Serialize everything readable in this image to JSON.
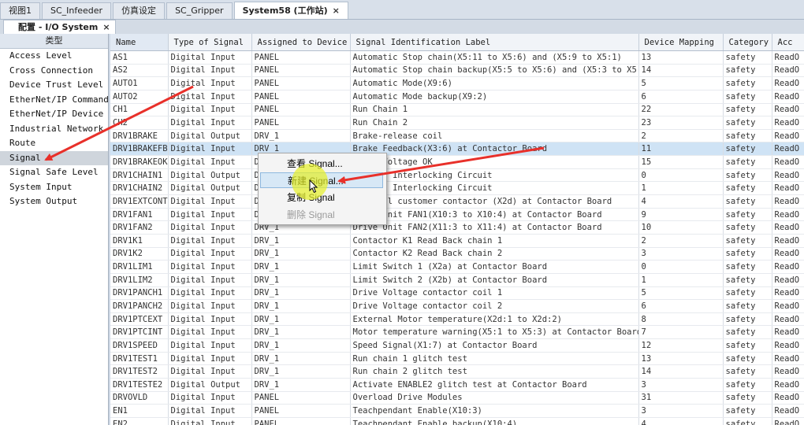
{
  "doc_tabs": [
    {
      "label": "视图1",
      "active": false
    },
    {
      "label": "SC_Infeeder",
      "active": false
    },
    {
      "label": "仿真设定",
      "active": false
    },
    {
      "label": "SC_Gripper",
      "active": false
    },
    {
      "label": "System58 (工作站)",
      "active": true
    }
  ],
  "sub_tab": {
    "label": "配置 - I/O System"
  },
  "left_panel": {
    "header": "类型",
    "items": [
      "Access Level",
      "Cross Connection",
      "Device Trust Level",
      "EtherNet/IP Command",
      "EtherNet/IP Device",
      "Industrial Network",
      "Route",
      "Signal",
      "Signal Safe Level",
      "System Input",
      "System Output"
    ],
    "selected": "Signal"
  },
  "table": {
    "columns": [
      "Name",
      "Type of Signal",
      "Assigned to Device",
      "Signal Identification Label",
      "Device Mapping",
      "Category",
      "Acc"
    ],
    "rows": [
      [
        "AS1",
        "Digital Input",
        "PANEL",
        "Automatic Stop chain(X5:11 to X5:6) and (X5:9 to X5:1)",
        "13",
        "safety",
        "ReadO"
      ],
      [
        "AS2",
        "Digital Input",
        "PANEL",
        "Automatic Stop chain backup(X5:5 to X5:6) and (X5:3 to X5:1)",
        "14",
        "safety",
        "ReadO"
      ],
      [
        "AUTO1",
        "Digital Input",
        "PANEL",
        "Automatic Mode(X9:6)",
        "5",
        "safety",
        "ReadO"
      ],
      [
        "AUTO2",
        "Digital Input",
        "PANEL",
        "Automatic Mode backup(X9:2)",
        "6",
        "safety",
        "ReadO"
      ],
      [
        "CH1",
        "Digital Input",
        "PANEL",
        "Run Chain 1",
        "22",
        "safety",
        "ReadO"
      ],
      [
        "CH2",
        "Digital Input",
        "PANEL",
        "Run Chain 2",
        "23",
        "safety",
        "ReadO"
      ],
      [
        "DRV1BRAKE",
        "Digital Output",
        "DRV_1",
        "Brake-release coil",
        "2",
        "safety",
        "ReadO"
      ],
      [
        "DRV1BRAKEFB",
        "Digital Input",
        "DRV_1",
        "Brake Feedback(X3:6) at Contactor Board",
        "11",
        "safety",
        "ReadO"
      ],
      [
        "DRV1BRAKEOK",
        "Digital Input",
        "DRV_1",
        "Brake Voltage OK",
        "15",
        "safety",
        "ReadO"
      ],
      [
        "DRV1CHAIN1",
        "Digital Output",
        "DRV_1",
        "Chain 1 Interlocking Circuit",
        "0",
        "safety",
        "ReadO"
      ],
      [
        "DRV1CHAIN2",
        "Digital Output",
        "DRV_1",
        "Chain 2 Interlocking Circuit",
        "1",
        "safety",
        "ReadO"
      ],
      [
        "DRV1EXTCONT",
        "Digital Input",
        "DRV_1",
        "External customer contactor (X2d) at Contactor Board",
        "4",
        "safety",
        "ReadO"
      ],
      [
        "DRV1FAN1",
        "Digital Input",
        "DRV_1",
        "Drive Unit FAN1(X10:3 to X10:4) at Contactor Board",
        "9",
        "safety",
        "ReadO"
      ],
      [
        "DRV1FAN2",
        "Digital Input",
        "DRV_1",
        "Drive Unit FAN2(X11:3 to X11:4) at Contactor Board",
        "10",
        "safety",
        "ReadO"
      ],
      [
        "DRV1K1",
        "Digital Input",
        "DRV_1",
        "Contactor K1 Read Back chain 1",
        "2",
        "safety",
        "ReadO"
      ],
      [
        "DRV1K2",
        "Digital Input",
        "DRV_1",
        "Contactor K2 Read Back chain 2",
        "3",
        "safety",
        "ReadO"
      ],
      [
        "DRV1LIM1",
        "Digital Input",
        "DRV_1",
        "Limit Switch 1 (X2a) at Contactor Board",
        "0",
        "safety",
        "ReadO"
      ],
      [
        "DRV1LIM2",
        "Digital Input",
        "DRV_1",
        "Limit Switch 2 (X2b) at Contactor Board",
        "1",
        "safety",
        "ReadO"
      ],
      [
        "DRV1PANCH1",
        "Digital Input",
        "DRV_1",
        "Drive Voltage contactor coil 1",
        "5",
        "safety",
        "ReadO"
      ],
      [
        "DRV1PANCH2",
        "Digital Input",
        "DRV_1",
        "Drive Voltage contactor coil 2",
        "6",
        "safety",
        "ReadO"
      ],
      [
        "DRV1PTCEXT",
        "Digital Input",
        "DRV_1",
        "External Motor temperature(X2d:1 to X2d:2)",
        "8",
        "safety",
        "ReadO"
      ],
      [
        "DRV1PTCINT",
        "Digital Input",
        "DRV_1",
        "Motor temperature warning(X5:1 to X5:3) at Contactor Board",
        "7",
        "safety",
        "ReadO"
      ],
      [
        "DRV1SPEED",
        "Digital Input",
        "DRV_1",
        "Speed Signal(X1:7) at Contactor Board",
        "12",
        "safety",
        "ReadO"
      ],
      [
        "DRV1TEST1",
        "Digital Input",
        "DRV_1",
        "Run chain 1 glitch test",
        "13",
        "safety",
        "ReadO"
      ],
      [
        "DRV1TEST2",
        "Digital Input",
        "DRV_1",
        "Run chain 2 glitch test",
        "14",
        "safety",
        "ReadO"
      ],
      [
        "DRV1TESTE2",
        "Digital Output",
        "DRV_1",
        "Activate ENABLE2 glitch test at Contactor Board",
        "3",
        "safety",
        "ReadO"
      ],
      [
        "DRVOVLD",
        "Digital Input",
        "PANEL",
        "Overload Drive Modules",
        "31",
        "safety",
        "ReadO"
      ],
      [
        "EN1",
        "Digital Input",
        "PANEL",
        "Teachpendant  Enable(X10:3)",
        "3",
        "safety",
        "ReadO"
      ],
      [
        "EN2",
        "Digital Input",
        "PANEL",
        "Teachpendant  Enable backup(X10:4)",
        "4",
        "safety",
        "ReadO"
      ]
    ]
  },
  "context_menu": {
    "items": [
      {
        "label": "查看 Signal...",
        "state": "normal"
      },
      {
        "label": "新建 Signal...",
        "state": "hover"
      },
      {
        "label": "复制 Signal",
        "state": "normal"
      },
      {
        "label": "删除 Signal",
        "state": "disabled"
      }
    ]
  },
  "colors": {
    "annotation_arrow": "#e8302a",
    "cursor_highlight": "#e6f028",
    "selected_row": "#cfe3f5"
  }
}
